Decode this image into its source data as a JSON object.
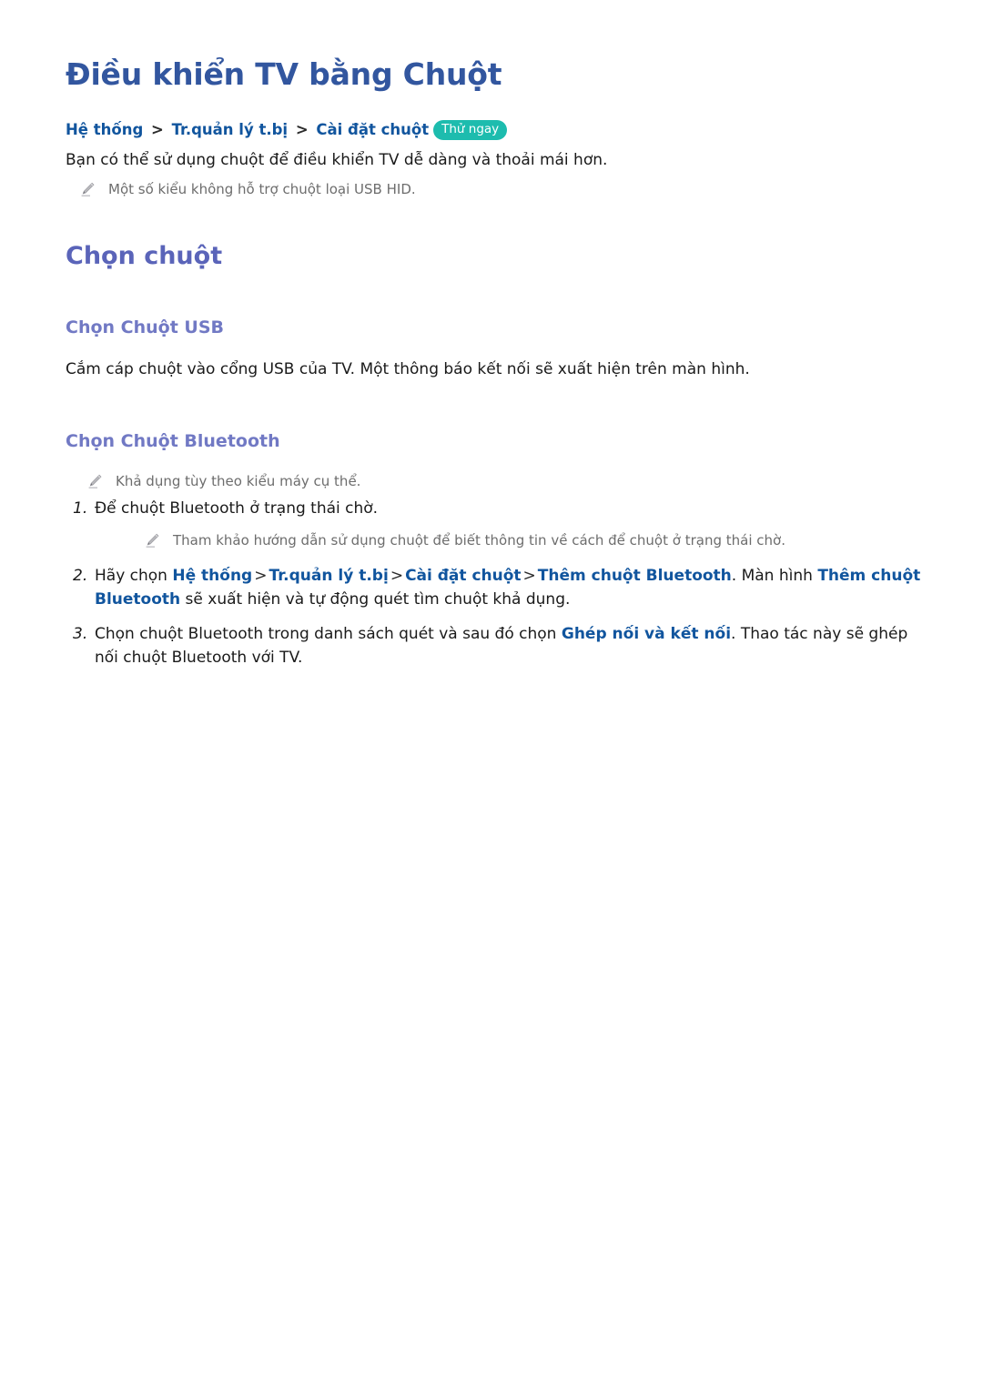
{
  "document": {
    "title": "Điều khiển TV bằng Chuột",
    "breadcrumb": {
      "items": [
        "Hệ thống",
        "Tr.quản lý t.bị",
        "Cài đặt chuột"
      ],
      "separator": ">",
      "badge_label": "Thử ngay"
    },
    "intro_paragraph": "Bạn có thể sử dụng chuột để điều khiển TV dễ dàng và thoải mái hơn.",
    "intro_note": "Một số kiểu không hỗ trợ chuột loại USB HID.",
    "section": {
      "heading": "Chọn chuột",
      "usb": {
        "heading": "Chọn Chuột USB",
        "paragraph": "Cắm cáp chuột vào cổng USB của TV. Một thông báo kết nối sẽ xuất hiện trên màn hình."
      },
      "bluetooth": {
        "heading": "Chọn Chuột Bluetooth",
        "note": "Khả dụng tùy theo kiểu máy cụ thể.",
        "steps": [
          {
            "number": "1.",
            "text": "Để chuột Bluetooth ở trạng thái chờ.",
            "note": "Tham khảo hướng dẫn sử dụng chuột để biết thông tin về cách để chuột ở trạng thái chờ."
          },
          {
            "number": "2.",
            "lead": "Hãy chọn ",
            "links": [
              "Hệ thống",
              "Tr.quản lý t.bị",
              "Cài đặt chuột",
              "Thêm chuột Bluetooth"
            ],
            "separator": ">",
            "mid": ". Màn hình ",
            "emphasis": "Thêm chuột Bluetooth",
            "tail": " sẽ xuất hiện và tự động quét tìm chuột khả dụng."
          },
          {
            "number": "3.",
            "lead": "Chọn chuột Bluetooth trong danh sách quét và sau đó chọn ",
            "emphasis": "Ghép nối và kết nối",
            "tail": ". Thao tác này sẽ ghép nối chuột Bluetooth với TV."
          }
        ]
      }
    }
  },
  "colors": {
    "title": "#32569f",
    "link": "#11559e",
    "h2": "#5a64b9",
    "h3": "#7179c4",
    "badge": "#1dbcae",
    "note_text": "#6d6d6d",
    "body_text": "#1a1a1a"
  },
  "icons": {
    "note": "pencil-icon"
  }
}
